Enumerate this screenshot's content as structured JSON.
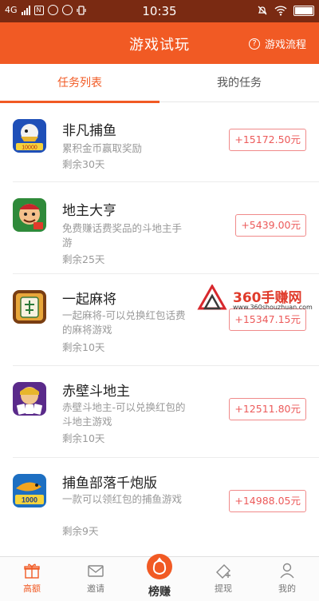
{
  "status_bar": {
    "network": "4G",
    "time": "10:35"
  },
  "header": {
    "title": "游戏试玩",
    "flow_label": "游戏流程",
    "help_glyph": "?"
  },
  "tabs": [
    {
      "label": "任务列表",
      "active": true
    },
    {
      "label": "我的任务",
      "active": false
    }
  ],
  "tasks": [
    {
      "name": "非凡捕鱼",
      "desc": "累积金币赢取奖励",
      "remaining": "剩余30天",
      "reward": "+15172.50元",
      "icon": "fishing-game-icon",
      "icon_text": "10000"
    },
    {
      "name": "地主大亨",
      "desc": "免费赚话费奖品的斗地主手游",
      "remaining": "剩余25天",
      "reward": "+5439.00元",
      "icon": "landlord-game-icon",
      "icon_text": ""
    },
    {
      "name": "一起麻将",
      "desc": "一起麻将-可以兑换红包话费的麻将游戏",
      "remaining": "剩余10天",
      "reward": "+15347.15元",
      "icon": "mahjong-game-icon",
      "icon_text": ""
    },
    {
      "name": "赤壁斗地主",
      "desc": "赤壁斗地主-可以兑换红包的斗地主游戏",
      "remaining": "剩余10天",
      "reward": "+12511.80元",
      "icon": "chibi-game-icon",
      "icon_text": ""
    },
    {
      "name": "捕鱼部落千炮版",
      "desc": "一款可以领红包的捕鱼游戏",
      "remaining": "剩余9天",
      "reward": "+14988.05元",
      "icon": "fish-tribe-game-icon",
      "icon_text": "1000"
    }
  ],
  "watermark": {
    "title": "360手赚网",
    "url": "www.360shouzhuan.com"
  },
  "bottom_nav": [
    {
      "label": "高额",
      "icon": "gift-icon",
      "active": true
    },
    {
      "label": "邀请",
      "icon": "mail-icon",
      "active": false
    },
    {
      "label": "榜赚",
      "icon": "coin-bag-icon",
      "active": false
    },
    {
      "label": "提现",
      "icon": "ticket-icon",
      "active": false
    },
    {
      "label": "我的",
      "icon": "user-icon",
      "active": false
    }
  ],
  "colors": {
    "accent": "#f15a24",
    "status_bar": "#7a2a12",
    "reward_border": "#f08a8a",
    "reward_text": "#ec5a5a"
  }
}
